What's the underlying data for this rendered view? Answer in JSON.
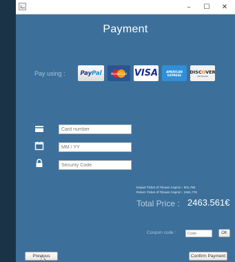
{
  "window": {
    "minimize_glyph": "–",
    "maximize_glyph": "☐",
    "close_glyph": "✕"
  },
  "page": {
    "title": "Payment",
    "pay_using_label": "Pay using :"
  },
  "payment_methods": [
    {
      "name": "PayPal",
      "icon": "paypal-logo"
    },
    {
      "name": "MasterCard",
      "icon": "mastercard-logo"
    },
    {
      "name": "VISA",
      "icon": "visa-logo"
    },
    {
      "name": "American Express",
      "icon": "amex-logo"
    },
    {
      "name": "DISCOVER",
      "icon": "discover-logo"
    }
  ],
  "logos": {
    "paypal_a": "Pay",
    "paypal_b": "Pal",
    "mastercard": "MasterCard",
    "visa": "VISA",
    "amex_a": "AMERICAN",
    "amex_b": "EXPRESS",
    "discover_a": "DISC",
    "discover_o": "O",
    "discover_b": "VER",
    "discover_sub": "NETWORK"
  },
  "form": {
    "card_number_placeholder": "Card number",
    "expiry_placeholder": "MM / YY",
    "security_code_placeholder": "Security Code"
  },
  "summary": {
    "depart_ticket": "Depart Ticket of Titouan Capron : 901,79€",
    "return_ticket": "Return Ticket of Titouan Capron : 1561,77€",
    "total_label": "Total Price :",
    "total_value": "2463.561€"
  },
  "coupon": {
    "label": "Coupon code :",
    "placeholder": "Code",
    "ok_label": "OK"
  },
  "buttons": {
    "previous": "Previous",
    "confirm": "Confirm Payment"
  },
  "colors": {
    "background": "#3c709b",
    "outer": "#1b3346",
    "title": "#ffffff"
  }
}
